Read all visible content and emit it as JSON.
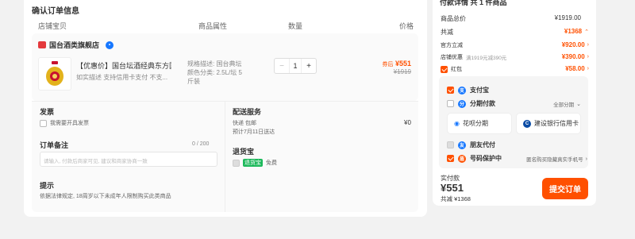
{
  "section_title": "确认订单信息",
  "columns": [
    "店铺宝贝",
    "商品属性",
    "数量",
    "价格"
  ],
  "shop": {
    "name": "国台酒类旗舰店"
  },
  "item": {
    "title": "【优惠价】国台坛酒经典东方国...",
    "subtitle": "如实描述  支持信用卡支付  不支...",
    "attr_line1": "规格描述: 国台典坛",
    "attr_line2": "颜色分类: 2.5L/坛 5",
    "attr_line3": "斤装",
    "qty": "1",
    "minus": "−",
    "plus": "+",
    "price_tag": "券后",
    "price": "¥551",
    "orig_price": "¥1919"
  },
  "invoice": {
    "title": "发票",
    "option": "我需要开具发票"
  },
  "remark": {
    "title": "订单备注",
    "counter": "0 / 200",
    "placeholder": "请输入, 付款后商家可见, 建议和商家协商一致"
  },
  "notice": {
    "title": "提示",
    "text": "依据法律规定, 18周岁以下未成年人限制购买此类商品"
  },
  "delivery": {
    "title": "配送服务",
    "method": "快递 包邮",
    "eta": "预计7月11日送达",
    "fee": "¥0"
  },
  "return_service": {
    "title": "退货宝",
    "badge": "退货宝",
    "note": "免费"
  },
  "summary": {
    "header": "付款详情 共 1 件商品",
    "goods_total_label": "商品总价",
    "goods_total": "¥1919.00",
    "discount_label": "共减",
    "discount": "¥1368",
    "official_label": "官方立减",
    "official": "¥920.00",
    "shop_label": "店铺优惠",
    "shop_note": "满1919元减390元",
    "shop_discount": "¥390.00",
    "redpacket_label": "红包",
    "redpacket": "¥58.00"
  },
  "payment": {
    "alipay": "支付宝",
    "installment": "分期付款",
    "installment_all": "全部分期",
    "huabei": "花呗分期",
    "ccb": "建设银行信用卡",
    "friend": "朋友代付",
    "privacy": "号码保护中",
    "privacy_note": "匿名购买隐藏真实手机号"
  },
  "footer": {
    "paid_label": "实付款",
    "paid": "¥551",
    "saved": "共减 ¥1368",
    "submit": "提交订单"
  },
  "colors": {
    "accent": "#ff5000",
    "alipay": "#1677ff",
    "return_green": "#1db95b"
  }
}
